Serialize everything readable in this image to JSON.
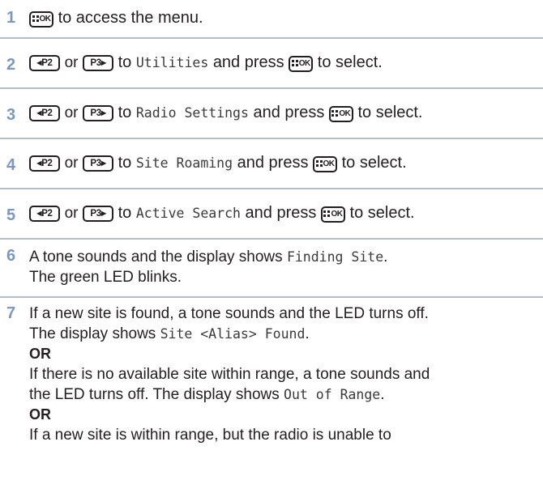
{
  "keys": {
    "menu_ok": "OK",
    "p2": "P2",
    "p3": "P3"
  },
  "steps": [
    {
      "number": "1",
      "text": "to access the menu."
    },
    {
      "number": "2",
      "or": "or",
      "to": "to",
      "target": "Utilities",
      "press": "and press",
      "select": "to select."
    },
    {
      "number": "3",
      "or": "or",
      "to": "to",
      "target": "Radio Settings",
      "press": "and press",
      "select": "to select."
    },
    {
      "number": "4",
      "or": "or",
      "to": "to",
      "target": "Site Roaming",
      "press": "and press",
      "select": "to select."
    },
    {
      "number": "5",
      "or": "or",
      "to": "to",
      "target": "Active Search",
      "press": "and press",
      "select": "to select."
    },
    {
      "number": "6",
      "line1_prefix": "A tone sounds and the display shows",
      "line1_mono": "Finding Site",
      "line1_suffix": ".",
      "line2": "The green LED blinks."
    },
    {
      "number": "7",
      "line1": "If a new site is found, a tone sounds and the LED turns off.",
      "line2_prefix": "The display shows",
      "line2_mono": "Site <Alias> Found",
      "line2_suffix": ".",
      "or1": "OR",
      "line3": "If there is no available site within range, a tone sounds and",
      "line4_prefix": "the LED turns off. The display shows",
      "line4_mono": "Out of Range",
      "line4_suffix": ".",
      "or2": "OR",
      "line5": "If a new site is within range, but the radio is unable to"
    }
  ]
}
